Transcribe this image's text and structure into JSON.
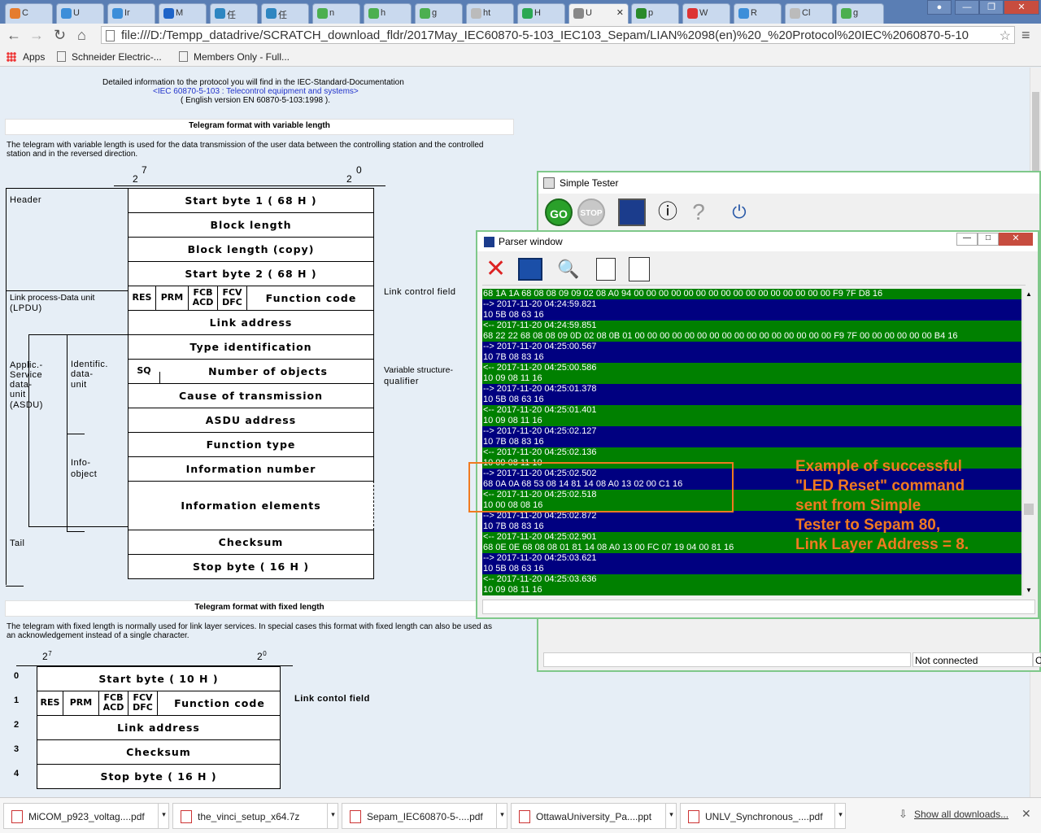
{
  "tabs": [
    {
      "label": "C",
      "color": "#e57c2e"
    },
    {
      "label": "U",
      "color": "#3c8ed9"
    },
    {
      "label": "Ir",
      "color": "#3c8ed9"
    },
    {
      "label": "M",
      "color": "#1e64c8"
    },
    {
      "label": "任",
      "color": "#2e86c1"
    },
    {
      "label": "任",
      "color": "#2e86c1"
    },
    {
      "label": "n",
      "color": "#4caf50"
    },
    {
      "label": "h",
      "color": "#4caf50"
    },
    {
      "label": "g",
      "color": "#4caf50"
    },
    {
      "label": "ht",
      "color": "#bbb"
    },
    {
      "label": "H",
      "color": "#2aa853"
    },
    {
      "label": "U",
      "color": "#888"
    },
    {
      "label": "p",
      "color": "#2a8a2a"
    },
    {
      "label": "W",
      "color": "#d33"
    },
    {
      "label": "R",
      "color": "#3c8ed9"
    },
    {
      "label": "Cl",
      "color": "#bbb"
    },
    {
      "label": "g",
      "color": "#4caf50"
    }
  ],
  "url": "file:///D:/Tempp_datadrive/SCRATCH_download_fldr/2017May_IEC60870-5-103_IEC103_Sepam/LIAN%2098(en)%20_%20Protocol%20IEC%2060870-5-10",
  "bookmarks": {
    "apps": "Apps",
    "b1": "Schneider Electric-...",
    "b2": "Members Only - Full..."
  },
  "doc": {
    "intro1": "Detailed information to the protocol you will find in the IEC-Standard-Documentation",
    "intro2": "<IEC 60870-5-103 : Telecontrol equipment and systems>",
    "intro3": "( English version EN 60870-5-103:1998 ).",
    "var_title": "Telegram format with variable length",
    "var_desc1": "The telegram with variable length is used for the data transmission of the user data between the controlling station and the controlled",
    "var_desc2": "station and in the reversed direction.",
    "bit_hi": "2",
    "bit_hi_exp": "7",
    "bit_lo": "2",
    "bit_lo_exp": "0",
    "rows": [
      "Start byte 1 ( 68 H )",
      "Block length",
      "Block length (copy)",
      "Start byte 2 ( 68 H )",
      "",
      "Link address",
      "Type identification",
      "",
      "Cause of transmission",
      "ASDU address",
      "Function type",
      "Information number",
      "Information elements",
      "Checksum",
      "Stop byte ( 16 H )"
    ],
    "ctrl": {
      "res": "RES",
      "prm": "PRM",
      "fcb": "FCB",
      "acd": "ACD",
      "fcv": "FCV",
      "dfc": "DFC",
      "fc": "Function code"
    },
    "sq": "SQ",
    "num_obj": "Number of objects",
    "left": {
      "header": "Header",
      "lpdu1": "Link process-Data unit",
      "lpdu2": "(LPDU)",
      "asdu1": "Applic.-",
      "asdu2": "Service",
      "asdu3": "data-",
      "asdu4": "unit",
      "asdu5": "(ASDU)",
      "ident1": "Identific.",
      "ident2": "data-",
      "ident3": "unit",
      "info1": "Info-",
      "info2": "object",
      "tail": "Tail"
    },
    "right": {
      "lcf": "Link control field",
      "vsq1": "Variable structure-",
      "vsq2": "qualifier"
    },
    "fix_title": "Telegram format with fixed length",
    "fix_desc1": "The telegram with fixed length is normally used for link layer services. In special cases this format with fixed length can also be used as",
    "fix_desc2": "an acknowledgement instead of a single character.",
    "fix_rows": [
      "Start byte ( 10 H )",
      "",
      "Link address",
      "Checksum",
      "Stop byte ( 16 H )"
    ],
    "fix_idx": [
      "0",
      "1",
      "2",
      "3",
      "4"
    ],
    "fix_lcf": "Link contol field"
  },
  "tester": {
    "title": "Simple Tester",
    "go": "GO",
    "stop": "STOP",
    "status": "Not connected",
    "status2": "O"
  },
  "parser": {
    "title": "Parser window",
    "lines": [
      {
        "t": "68 1A 1A 68 08 08 09 09 02 08 A0 94 00 00 00 00 00 00 00 00 00 00 00 00 00 00 00 00 F9 7F D8 16",
        "c": "g"
      },
      {
        "t": "--> 2017-11-20 04:24:59.821",
        "c": "b"
      },
      {
        "t": "10 5B 08 63 16",
        "c": "b"
      },
      {
        "t": "<-- 2017-11-20 04:24:59.851",
        "c": "g"
      },
      {
        "t": "68 22 22 68 08 08 09 0D 02 08 0B 01 00 00 00 00 00 00 00 00 00 00 00 00 00 00 00 00 F9 7F 00 00 00 00 00 00 B4 16",
        "c": "g"
      },
      {
        "t": "--> 2017-11-20 04:25:00.567",
        "c": "b"
      },
      {
        "t": "10 7B 08 83 16",
        "c": "b"
      },
      {
        "t": "<-- 2017-11-20 04:25:00.586",
        "c": "g"
      },
      {
        "t": "10 09 08 11 16",
        "c": "g"
      },
      {
        "t": "--> 2017-11-20 04:25:01.378",
        "c": "b"
      },
      {
        "t": "10 5B 08 63 16",
        "c": "b"
      },
      {
        "t": "<-- 2017-11-20 04:25:01.401",
        "c": "g"
      },
      {
        "t": "10 09 08 11 16",
        "c": "g"
      },
      {
        "t": "--> 2017-11-20 04:25:02.127",
        "c": "b"
      },
      {
        "t": "10 7B 08 83 16",
        "c": "b"
      },
      {
        "t": "<-- 2017-11-20 04:25:02.136",
        "c": "g"
      },
      {
        "t": "10 09 08 11 10",
        "c": "g"
      },
      {
        "t": "--> 2017-11-20 04:25:02.502",
        "c": "b"
      },
      {
        "t": "68 0A 0A 68 53 08 14 81 14 08 A0 13 02 00 C1 16",
        "c": "b"
      },
      {
        "t": "<-- 2017-11-20 04:25:02.518",
        "c": "g"
      },
      {
        "t": "10 00 08 08 16",
        "c": "g"
      },
      {
        "t": "--> 2017-11-20 04:25:02.872",
        "c": "b"
      },
      {
        "t": "10 7B 08 83 16",
        "c": "b"
      },
      {
        "t": "<-- 2017-11-20 04:25:02.901",
        "c": "g"
      },
      {
        "t": "68 0E 0E 68 08 08 01 81 14 08 A0 13 00 FC 07 19 04 00 81 16",
        "c": "g"
      },
      {
        "t": "--> 2017-11-20 04:25:03.621",
        "c": "b"
      },
      {
        "t": "10 5B 08 63 16",
        "c": "b"
      },
      {
        "t": "<-- 2017-11-20 04:25:03.636",
        "c": "g"
      },
      {
        "t": "10 09 08 11 16",
        "c": "g"
      }
    ]
  },
  "callout": "Example of successful\n\"LED Reset\" command\nsent from Simple\nTester to Sepam 80,\nLink Layer Address = 8.",
  "downloads": [
    "MiCOM_p923_voltag....pdf",
    "the_vinci_setup_x64.7z",
    "Sepam_IEC60870-5-....pdf",
    "OttawaUniversity_Pa....ppt",
    "UNLV_Synchronous_....pdf"
  ],
  "show_all": "Show all downloads..."
}
